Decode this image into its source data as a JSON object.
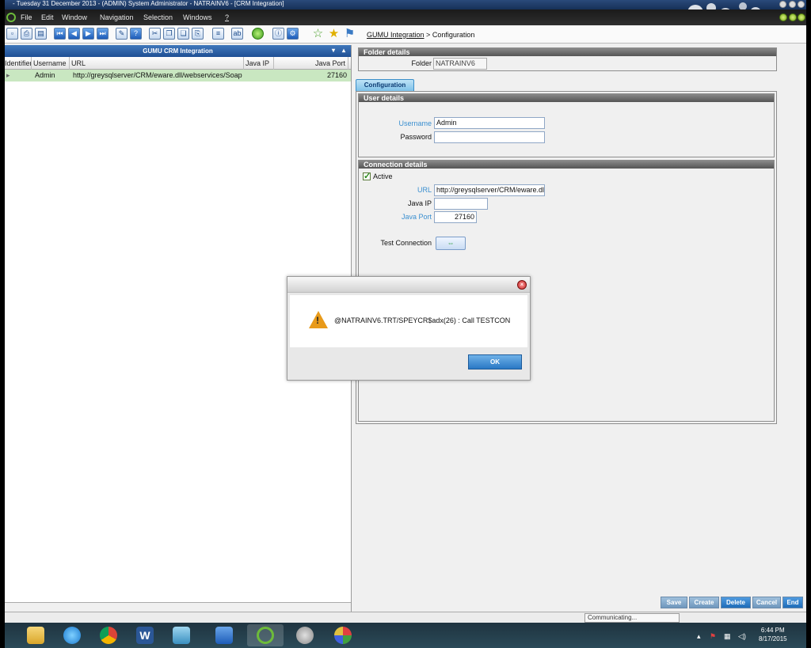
{
  "window": {
    "title": "- Tuesday 31 December 2013 - (ADMIN) System Administrator - NATRAINV6 - [CRM Integration]"
  },
  "menu": {
    "items": [
      "File",
      "Edit",
      "Window",
      "Navigation",
      "Selection",
      "Windows",
      "?"
    ]
  },
  "breadcrumb": {
    "link": "GUMU Integration",
    "separator": ">",
    "current": "Configuration"
  },
  "left_panel": {
    "title": "GUMU CRM Integration",
    "columns": [
      "Identifier",
      "Username",
      "URL",
      "Java IP",
      "Java Port"
    ],
    "rows": [
      {
        "identifier": "",
        "username": "Admin",
        "url": "http://greysqlserver/CRM/eware.dll/webservices/Soap",
        "java_ip": "",
        "java_port": "27160"
      }
    ]
  },
  "folder_details": {
    "header": "Folder details",
    "folder_label": "Folder",
    "folder_value": "NATRAINV6"
  },
  "tab": {
    "label": "Configuration"
  },
  "user_details": {
    "header": "User details",
    "username_label": "Username",
    "username_value": "Admin",
    "password_label": "Password",
    "password_value": ""
  },
  "connection_details": {
    "header": "Connection details",
    "active_label": "Active",
    "active": true,
    "url_label": "URL",
    "url_value": "http://greysqlserver/CRM/eware.dll",
    "java_ip_label": "Java IP",
    "java_ip_value": "",
    "java_port_label": "Java Port",
    "java_port_value": "27160",
    "test_label": "Test Connection"
  },
  "dialog": {
    "message": "@NATRAINV6.TRT/SPEYCR$adx(26) : Call TESTCON",
    "ok_label": "OK"
  },
  "bottom_buttons": [
    "Save",
    "Create",
    "Delete",
    "Cancel",
    "End"
  ],
  "status": {
    "text": "Communicating..."
  },
  "taskbar": {
    "time": "6:44 PM",
    "date": "8/17/2015"
  },
  "colors": {
    "accent_blue": "#2a78c4",
    "label_blue": "#3a8fd0",
    "row_green": "#c9e7c1",
    "warning": "#e89a1a"
  }
}
